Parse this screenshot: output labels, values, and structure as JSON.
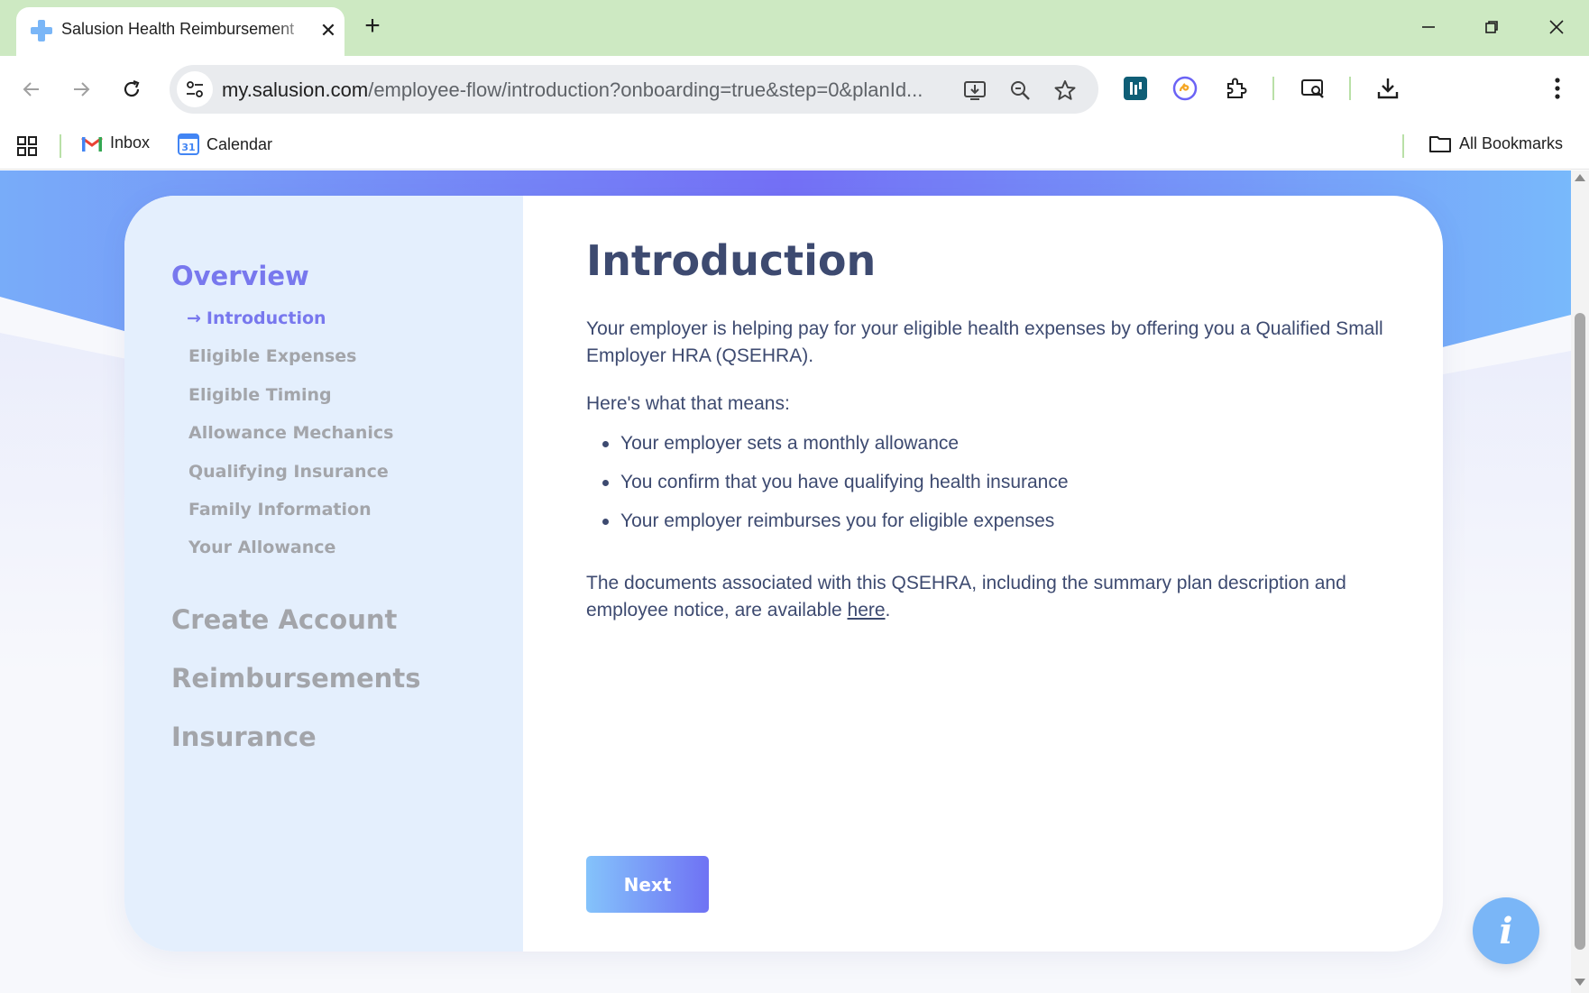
{
  "browser": {
    "tab": {
      "title": "Salusion Health Reimbursement"
    },
    "url": {
      "host": "my.salusion.com",
      "path": "/employee-flow/introduction?onboarding=true&step=0&planId..."
    },
    "bookmarks": [
      {
        "label": "Inbox"
      },
      {
        "label": "Calendar"
      }
    ],
    "all_bookmarks": "All Bookmarks",
    "calendar_day": "31",
    "colors": {
      "tab_strip": "#cde9c2",
      "omnibox": "#e9ebee"
    }
  },
  "sidebar": {
    "sections": [
      {
        "title": "Overview",
        "active": true,
        "items": [
          {
            "label": "Introduction",
            "active": true
          },
          {
            "label": "Eligible Expenses"
          },
          {
            "label": "Eligible Timing"
          },
          {
            "label": "Allowance Mechanics"
          },
          {
            "label": "Qualifying Insurance"
          },
          {
            "label": "Family Information"
          },
          {
            "label": "Your Allowance"
          }
        ]
      },
      {
        "title": "Create Account"
      },
      {
        "title": "Reimbursements"
      },
      {
        "title": "Insurance"
      }
    ],
    "active_arrow": "→"
  },
  "content": {
    "title": "Introduction",
    "intro": "Your employer is helping pay for your eligible health expenses by offering you a Qualified Small Employer HRA (QSEHRA).",
    "means_label": "Here's what that means:",
    "bullets": [
      "Your employer sets a monthly allowance",
      "You confirm that you have qualifying health insurance",
      "Your employer reimburses you for eligible expenses"
    ],
    "docs_text": "The documents associated with this QSEHRA, including the summary plan description and employee notice, are available ",
    "docs_link": "here",
    "docs_end": ".",
    "next_button": "Next"
  },
  "info_button": {
    "glyph": "i"
  },
  "colors": {
    "accent": "#7878ee",
    "heading": "#3d4a70",
    "muted": "#a3a5aa",
    "sidebar_bg": "#e4effd",
    "button_gradient_start": "#84c3fb",
    "button_gradient_end": "#6f72f4",
    "info_button": "#7ab6f7"
  }
}
